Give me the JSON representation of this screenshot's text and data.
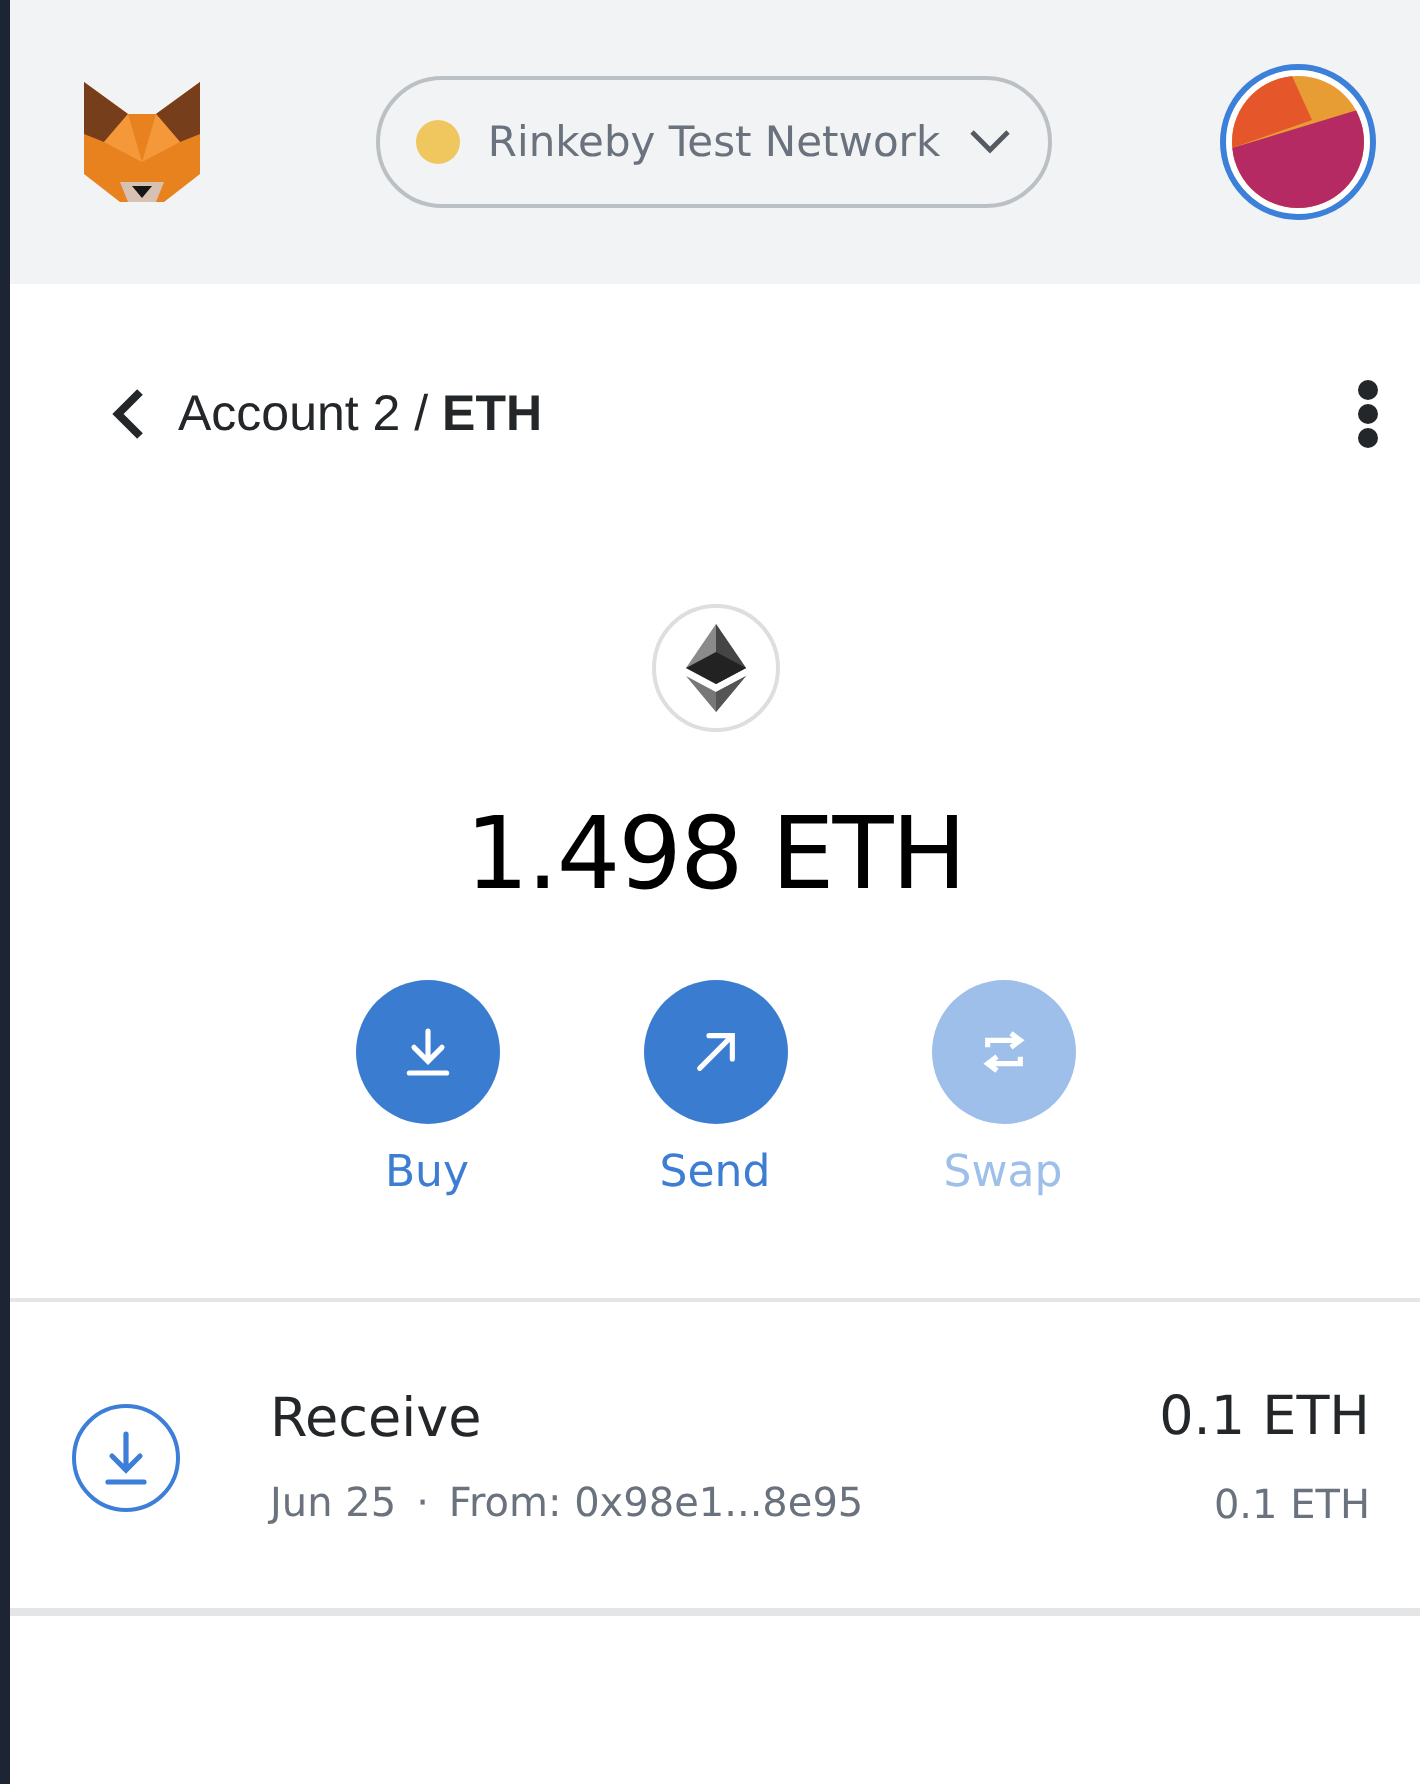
{
  "network": {
    "label": "Rinkeby Test Network",
    "color": "#f0c75e"
  },
  "asset_header": {
    "title": "Account 2 / **ETH**"
  },
  "balance": "1.498 ETH",
  "actions": [
    {
      "kind": "buy",
      "label": "Buy",
      "disabled": false
    },
    {
      "kind": "send",
      "label": "Send",
      "disabled": false
    },
    {
      "kind": "swap",
      "label": "Swap",
      "disabled": true
    }
  ],
  "transactions": [
    {
      "kind": "receive",
      "title": "Receive",
      "date": "Jun 25",
      "separator": "·",
      "from": "From: 0x98e1...8e95",
      "amount": "0.1 ETH",
      "fiat": "0.1 ETH"
    }
  ]
}
